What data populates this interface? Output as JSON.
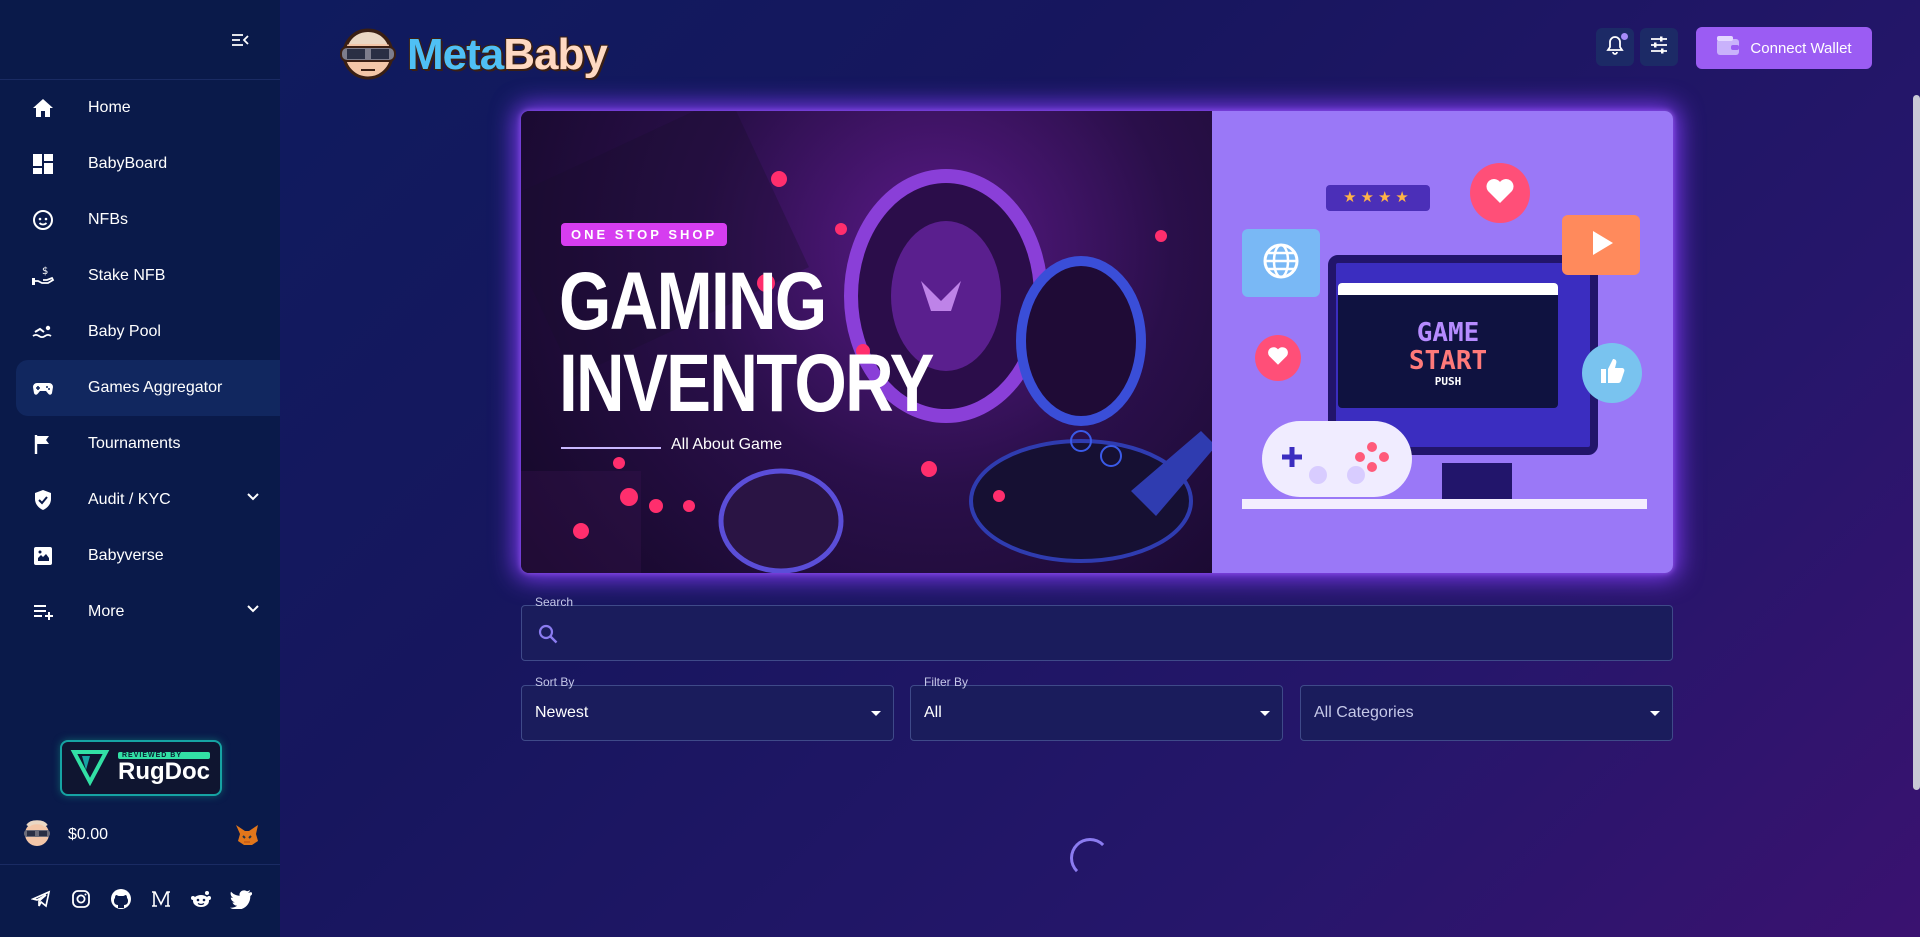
{
  "sidebar": {
    "items": [
      {
        "label": "Home",
        "icon": "home-icon"
      },
      {
        "label": "BabyBoard",
        "icon": "dashboard-icon"
      },
      {
        "label": "NFBs",
        "icon": "baby-face-icon"
      },
      {
        "label": "Stake NFB",
        "icon": "stake-hand-icon"
      },
      {
        "label": "Baby Pool",
        "icon": "swimmer-icon"
      },
      {
        "label": "Games Aggregator",
        "icon": "gamepad-icon",
        "active": true
      },
      {
        "label": "Tournaments",
        "icon": "flag-icon"
      },
      {
        "label": "Audit / KYC",
        "icon": "shield-check-icon",
        "expandable": true
      },
      {
        "label": "Babyverse",
        "icon": "babyverse-icon"
      },
      {
        "label": "More",
        "icon": "playlist-add-icon",
        "expandable": true
      }
    ],
    "rugdoc": {
      "small": "REVIEWED BY",
      "big": "RugDoc"
    },
    "balance": "$0.00",
    "socials": [
      "telegram-icon",
      "instagram-icon",
      "github-icon",
      "medium-icon",
      "reddit-icon",
      "twitter-icon"
    ]
  },
  "header": {
    "logo_meta": "Meta",
    "logo_baby": "Baby",
    "wallet_label": "Connect Wallet"
  },
  "banner": {
    "tag": "ONE STOP SHOP",
    "title_line1": "GAMING",
    "title_line2": "INVENTORY",
    "subtitle": "All About Game",
    "screen_line1": "GAME",
    "screen_line2": "START",
    "screen_line3": "PUSH",
    "stars": "★★★★"
  },
  "search": {
    "label": "Search",
    "placeholder": ""
  },
  "filters": {
    "sort_label": "Sort By",
    "sort_value": "Newest",
    "filter_label": "Filter By",
    "filter_value": "All",
    "category_value": "All Categories"
  },
  "colors": {
    "accent": "#9b5cf3",
    "sidebar_bg": "#0a1a4a",
    "active_bg": "#11275f"
  }
}
